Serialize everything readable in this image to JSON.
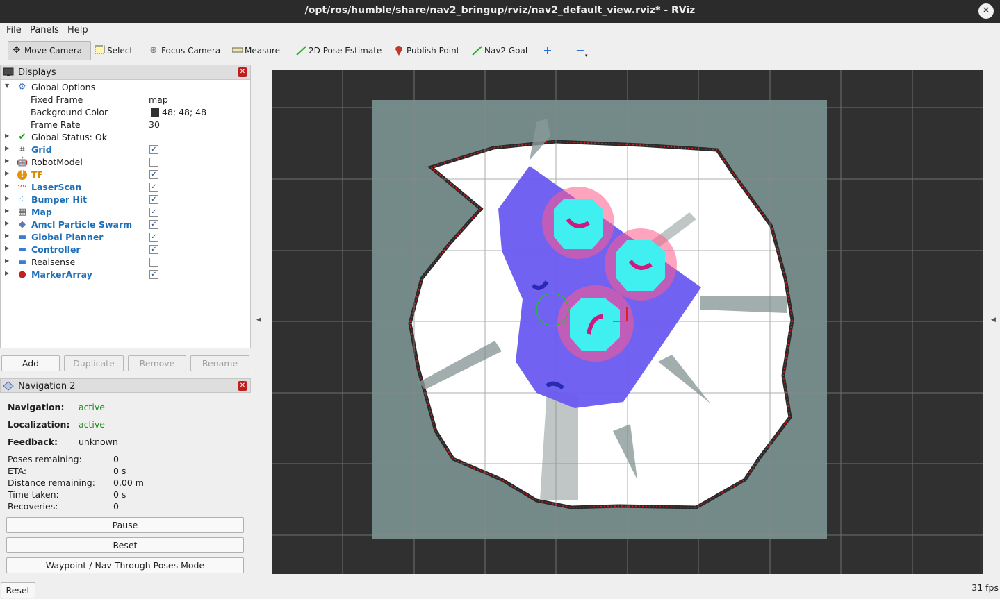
{
  "window": {
    "title": "/opt/ros/humble/share/nav2_bringup/rviz/nav2_default_view.rviz* - RViz",
    "close_glyph": "✕"
  },
  "menu": [
    "File",
    "Panels",
    "Help"
  ],
  "toolbar": {
    "move_camera": "Move Camera",
    "select": "Select",
    "focus_camera": "Focus Camera",
    "measure": "Measure",
    "pose_estimate": "2D Pose Estimate",
    "publish_point": "Publish Point",
    "nav2_goal": "Nav2 Goal"
  },
  "displays": {
    "title": "Displays",
    "global_options": "Global Options",
    "fixed_frame_label": "Fixed Frame",
    "fixed_frame_value": "map",
    "bg_color_label": "Background Color",
    "bg_color_value": "48; 48; 48",
    "frame_rate_label": "Frame Rate",
    "frame_rate_value": "30",
    "global_status": "Global Status: Ok",
    "items": [
      {
        "label": "Grid",
        "checked": true,
        "style": "blue",
        "icon": "grid-icon"
      },
      {
        "label": "RobotModel",
        "checked": false,
        "style": "plain",
        "icon": "robot-icon"
      },
      {
        "label": "TF",
        "checked": true,
        "style": "orange",
        "icon": "warning-icon"
      },
      {
        "label": "LaserScan",
        "checked": true,
        "style": "blue",
        "icon": "laserscan-icon"
      },
      {
        "label": "Bumper Hit",
        "checked": true,
        "style": "blue",
        "icon": "pointcloud-icon"
      },
      {
        "label": "Map",
        "checked": true,
        "style": "blue",
        "icon": "map-icon"
      },
      {
        "label": "Amcl Particle Swarm",
        "checked": true,
        "style": "blue",
        "icon": "pose-array-icon"
      },
      {
        "label": "Global Planner",
        "checked": true,
        "style": "blue",
        "icon": "folder-icon"
      },
      {
        "label": "Controller",
        "checked": true,
        "style": "blue",
        "icon": "folder-icon"
      },
      {
        "label": "Realsense",
        "checked": false,
        "style": "plain",
        "icon": "folder-icon"
      },
      {
        "label": "MarkerArray",
        "checked": true,
        "style": "blue",
        "icon": "marker-icon"
      }
    ],
    "buttons": {
      "add": "Add",
      "duplicate": "Duplicate",
      "remove": "Remove",
      "rename": "Rename"
    }
  },
  "navigation": {
    "title": "Navigation 2",
    "navigation_label": "Navigation:",
    "navigation_value": "active",
    "localization_label": "Localization:",
    "localization_value": "active",
    "feedback_label": "Feedback:",
    "feedback_value": "unknown",
    "poses_label": "Poses remaining:",
    "poses_value": "0",
    "eta_label": "ETA:",
    "eta_value": "0 s",
    "distance_label": "Distance remaining:",
    "distance_value": "0.00 m",
    "time_label": "Time taken:",
    "time_value": "0 s",
    "recoveries_label": "Recoveries:",
    "recoveries_value": "0",
    "pause": "Pause",
    "reset": "Reset",
    "waypoint": "Waypoint / Nav Through Poses Mode"
  },
  "bottom": {
    "reset": "Reset",
    "fps": "31 fps"
  },
  "colors": {
    "viewport_bg": "#303030",
    "map_unknown": "#738a89",
    "costmap": "#6a5af0"
  }
}
